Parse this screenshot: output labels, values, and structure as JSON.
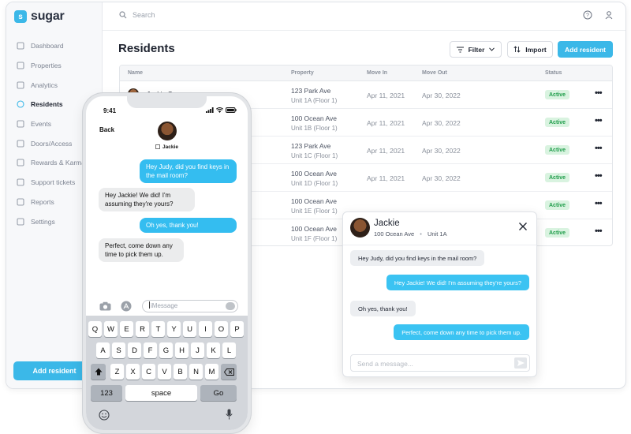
{
  "app": {
    "logo_text": "sugar",
    "nav": [
      {
        "label": "Dashboard",
        "icon": "dashboard-icon"
      },
      {
        "label": "Properties",
        "icon": "building-icon"
      },
      {
        "label": "Analytics",
        "icon": "analytics-icon"
      },
      {
        "label": "Residents",
        "icon": "residents-icon",
        "active": true
      },
      {
        "label": "Events",
        "icon": "calendar-icon"
      },
      {
        "label": "Doors/Access",
        "icon": "lock-icon"
      },
      {
        "label": "Rewards & Karma",
        "icon": "gift-icon"
      },
      {
        "label": "Support tickets",
        "icon": "help-icon"
      },
      {
        "label": "Reports",
        "icon": "document-icon"
      },
      {
        "label": "Settings",
        "icon": "gear-icon"
      }
    ],
    "sidebar_add_label": "Add resident",
    "search_placeholder": "Search",
    "page_title": "Residents",
    "filter_label": "Filter",
    "import_label": "Import",
    "add_label": "Add resident",
    "colors": {
      "accent": "#3bb8e8",
      "active_badge_bg": "#d9f3e0",
      "active_badge_text": "#1f9d4a"
    }
  },
  "table": {
    "headers": {
      "name": "Name",
      "property": "Property",
      "move_in": "Move In",
      "move_out": "Move Out",
      "status": "Status"
    },
    "rows": [
      {
        "name": "Jackie Cooper",
        "address": "123 Park Ave",
        "unit": "Unit 1A (Floor 1)",
        "move_in": "Apr 11, 2021",
        "move_out": "Apr 30, 2022",
        "status": "Active"
      },
      {
        "name": "",
        "address": "100 Ocean Ave",
        "unit": "Unit 1B (Floor 1)",
        "move_in": "Apr 11, 2021",
        "move_out": "Apr 30, 2022",
        "status": "Active"
      },
      {
        "name": "",
        "address": "123 Park Ave",
        "unit": "Unit 1C (Floor 1)",
        "move_in": "Apr 11, 2021",
        "move_out": "Apr 30, 2022",
        "status": "Active"
      },
      {
        "name": "",
        "address": "100 Ocean Ave",
        "unit": "Unit 1D (Floor 1)",
        "move_in": "Apr 11, 2021",
        "move_out": "Apr 30, 2022",
        "status": "Active"
      },
      {
        "name": "",
        "address": "100 Ocean Ave",
        "unit": "Unit 1E (Floor 1)",
        "move_in": "",
        "move_out": "",
        "status": "Active"
      },
      {
        "name": "",
        "address": "100 Ocean Ave",
        "unit": "Unit 1F (Floor 1)",
        "move_in": "",
        "move_out": "",
        "status": "Active"
      }
    ]
  },
  "chat": {
    "name": "Jackie",
    "address": "100 Ocean Ave",
    "unit": "Unit 1A",
    "messages": [
      {
        "from": "in",
        "text": "Hey Judy, did you find keys in the mail room?"
      },
      {
        "from": "out",
        "text": "Hey Jackie! We did! I'm assuming they're yours?"
      },
      {
        "from": "in",
        "text": "Oh yes, thank you!"
      },
      {
        "from": "out",
        "text": "Perfect, come down any time to pick them up."
      }
    ],
    "input_placeholder": "Send a message..."
  },
  "phone": {
    "time": "9:41",
    "back_label": "Back",
    "contact_name": "Jackie",
    "messages": [
      {
        "from": "out",
        "text": "Hey Judy, did you find keys in the mail room?"
      },
      {
        "from": "in",
        "text": "Hey Jackie! We did! I'm assuming they're yours?"
      },
      {
        "from": "out",
        "text": "Oh yes, thank you!"
      },
      {
        "from": "in",
        "text": "Perfect, come down any time to pick them up."
      }
    ],
    "message_placeholder": "iMessage",
    "keyboard": {
      "row1": [
        "Q",
        "W",
        "E",
        "R",
        "T",
        "Y",
        "U",
        "I",
        "O",
        "P"
      ],
      "row2": [
        "A",
        "S",
        "D",
        "F",
        "G",
        "H",
        "J",
        "K",
        "L"
      ],
      "row3": [
        "Z",
        "X",
        "C",
        "V",
        "B",
        "N",
        "M"
      ],
      "numbers_key": "123",
      "space_key": "space",
      "go_key": "Go"
    }
  }
}
